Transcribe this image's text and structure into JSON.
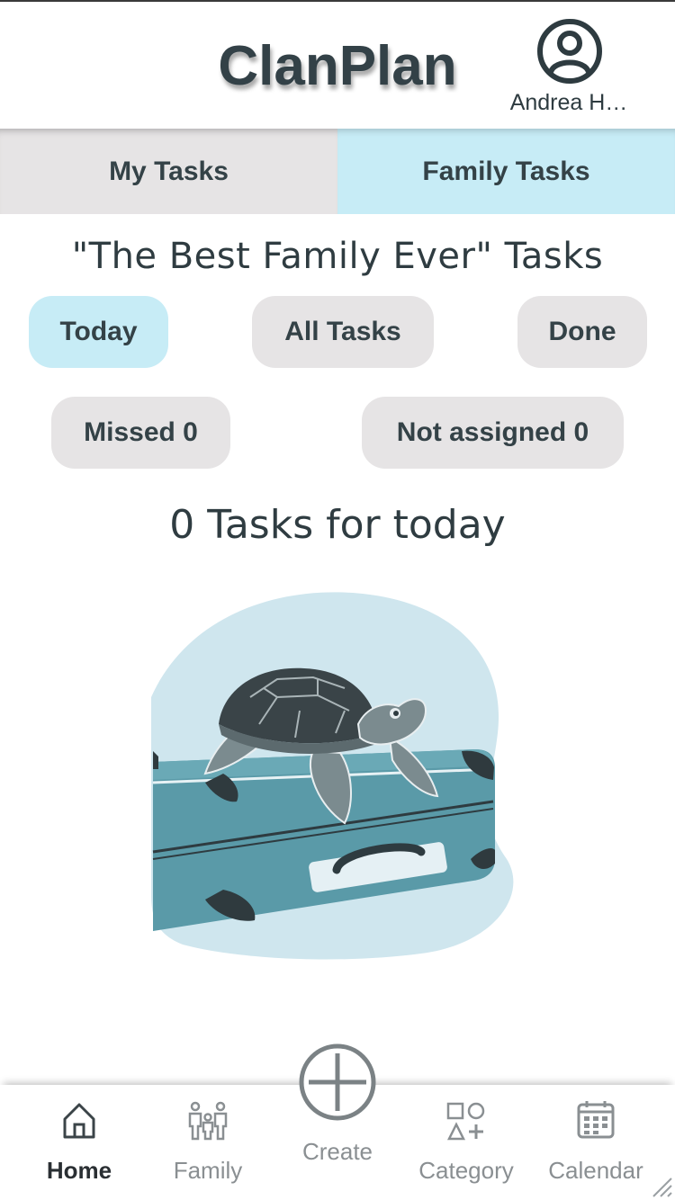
{
  "app": {
    "title": "ClanPlan"
  },
  "profile": {
    "name": "Andrea H…",
    "icon": "user-circle-icon"
  },
  "tabs": [
    {
      "label": "My Tasks",
      "active": false
    },
    {
      "label": "Family Tasks",
      "active": true
    }
  ],
  "section": {
    "title": "\"The Best Family Ever\" Tasks"
  },
  "filters": {
    "today": "Today",
    "all_tasks": "All Tasks",
    "done": "Done",
    "missed": "Missed 0",
    "not_assigned": "Not assigned 0",
    "active": "Today"
  },
  "empty_state": {
    "count_text": "0 Tasks for today",
    "illustration": "turtle-on-suitcase"
  },
  "bottom_nav": {
    "home": {
      "label": "Home",
      "icon": "home-icon"
    },
    "family": {
      "label": "Family",
      "icon": "family-icon"
    },
    "create": {
      "label": "Create",
      "icon": "plus-circle-icon"
    },
    "category": {
      "label": "Category",
      "icon": "category-icon"
    },
    "calendar": {
      "label": "Calendar",
      "icon": "calendar-icon"
    },
    "active": "Home"
  },
  "colors": {
    "accent": "#c7ecf6",
    "chip": "#e6e4e5",
    "text": "#2e3b40",
    "suitcase": "#5a9aa8"
  }
}
